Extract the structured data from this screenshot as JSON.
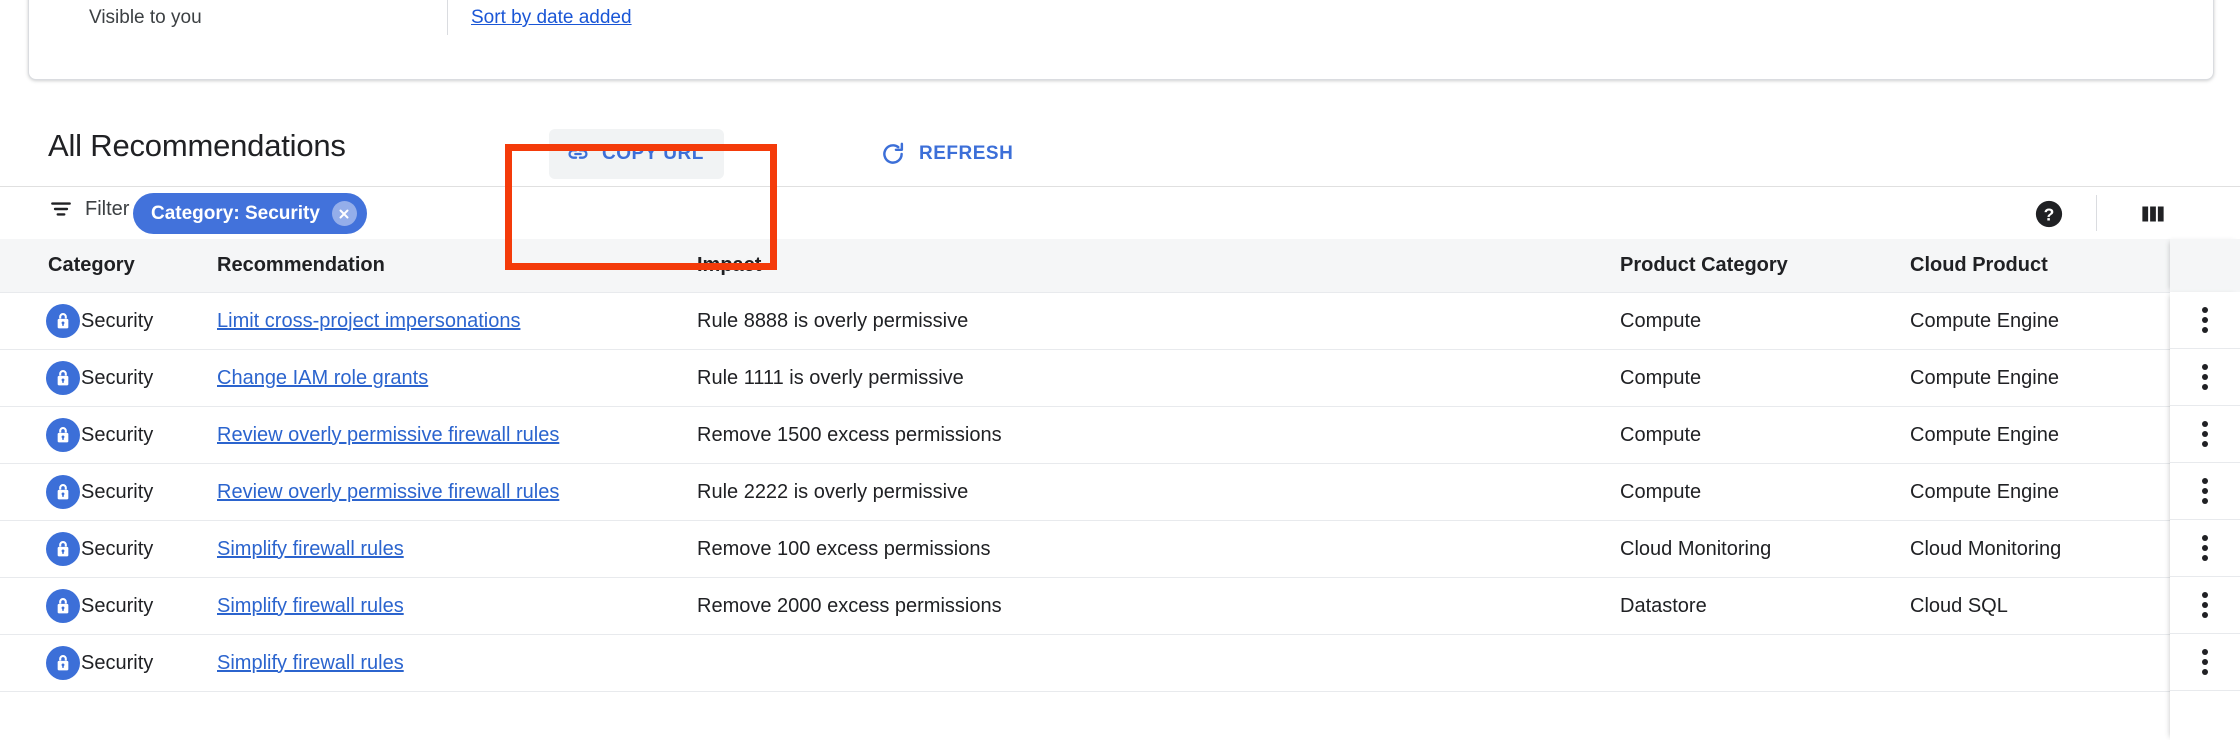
{
  "top_card": {
    "visibility_label": "Visible to you",
    "sort_link": "Sort by date added"
  },
  "section": {
    "title": "All Recommendations",
    "copy_url_label": "COPY URL",
    "refresh_label": "REFRESH"
  },
  "filter_bar": {
    "filter_label": "Filter",
    "chip_label": "Category: Security"
  },
  "colors": {
    "accent_blue": "#3c6fd8",
    "link_blue": "#2b64ce",
    "chip_blue": "#4272db",
    "highlight_red": "#f43b0a",
    "header_gray": "#f5f6f7"
  },
  "table": {
    "columns": [
      "Category",
      "Recommendation",
      "Impact",
      "Product Category",
      "Cloud Product"
    ],
    "rows": [
      {
        "category": "Security",
        "recommendation": "Limit cross-project impersonations",
        "impact": "Rule 8888 is overly permissive",
        "product_category": "Compute",
        "cloud_product": "Compute Engine"
      },
      {
        "category": "Security",
        "recommendation": "Change IAM role grants",
        "impact": "Rule 1111 is overly permissive",
        "product_category": "Compute",
        "cloud_product": "Compute Engine"
      },
      {
        "category": "Security",
        "recommendation": "Review overly permissive firewall rules",
        "impact": "Remove 1500 excess permissions",
        "product_category": "Compute",
        "cloud_product": "Compute Engine"
      },
      {
        "category": "Security",
        "recommendation": "Review overly permissive firewall rules",
        "impact": "Rule 2222 is overly permissive",
        "product_category": "Compute",
        "cloud_product": "Compute Engine"
      },
      {
        "category": "Security",
        "recommendation": "Simplify firewall rules",
        "impact": "Remove 100 excess permissions",
        "product_category": "Cloud Monitoring",
        "cloud_product": "Cloud Monitoring"
      },
      {
        "category": "Security",
        "recommendation": "Simplify firewall rules",
        "impact": "Remove 2000 excess permissions",
        "product_category": "Datastore",
        "cloud_product": "Cloud SQL"
      },
      {
        "category": "Security",
        "recommendation": "Simplify firewall rules",
        "impact": "",
        "product_category": "",
        "cloud_product": ""
      }
    ]
  },
  "icons": {
    "link": "link-icon",
    "refresh": "refresh-icon",
    "filter": "filter-icon",
    "close": "close-icon",
    "help": "help-icon",
    "columns": "columns-icon",
    "lock": "lock-icon",
    "overflow": "more-vert-icon"
  }
}
